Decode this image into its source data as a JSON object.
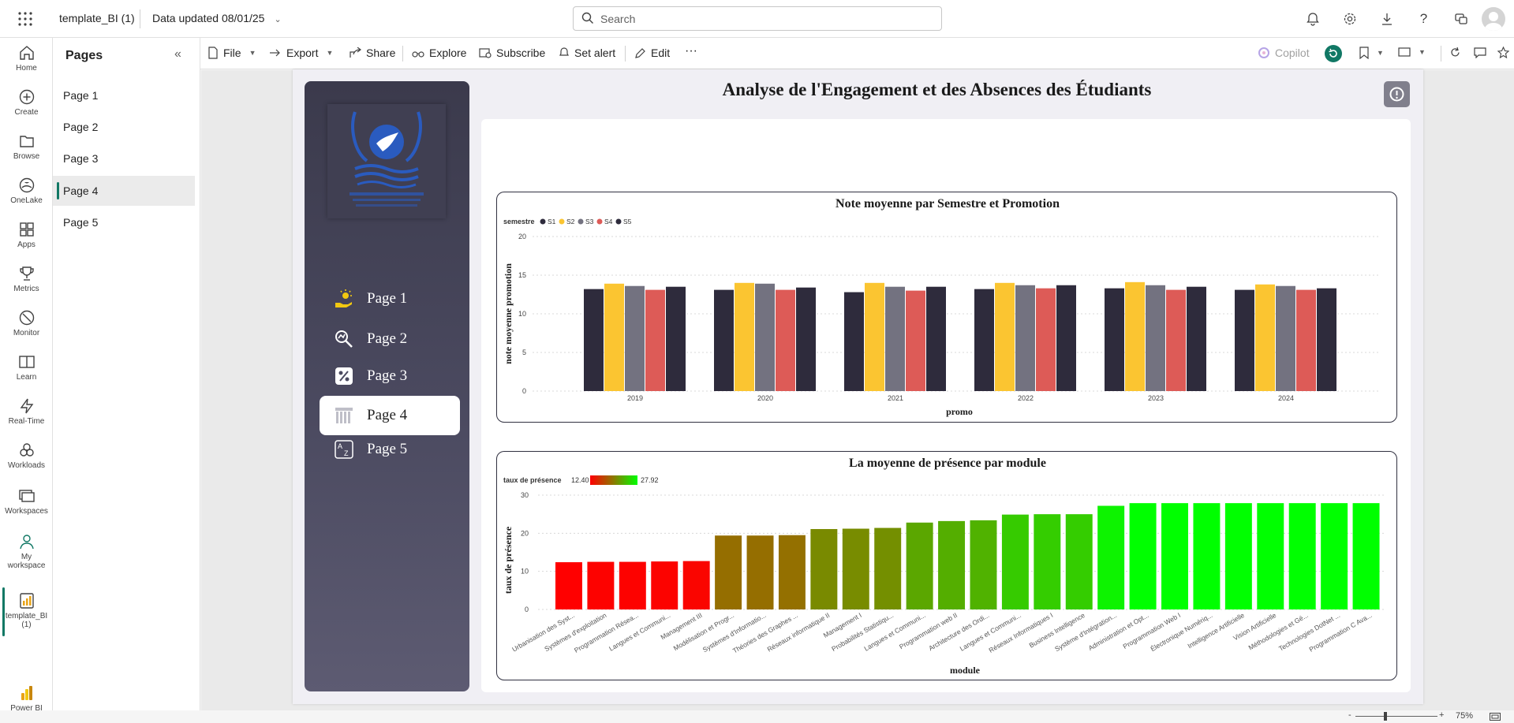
{
  "topbar": {
    "app_title": "template_BI (1)",
    "data_updated": "Data updated 08/01/25",
    "search_placeholder": "Search"
  },
  "rail": [
    {
      "label": "Home",
      "icon": "home-icon"
    },
    {
      "label": "Create",
      "icon": "create-icon"
    },
    {
      "label": "Browse",
      "icon": "browse-icon"
    },
    {
      "label": "OneLake",
      "icon": "onelake-icon"
    },
    {
      "label": "Apps",
      "icon": "apps-icon"
    },
    {
      "label": "Metrics",
      "icon": "metrics-icon"
    },
    {
      "label": "Monitor",
      "icon": "monitor-icon"
    },
    {
      "label": "Learn",
      "icon": "learn-icon"
    },
    {
      "label": "Real-Time",
      "icon": "real-time-icon"
    },
    {
      "label": "Workloads",
      "icon": "workloads-icon"
    },
    {
      "label": "Workspaces",
      "icon": "workspaces-icon"
    },
    {
      "label_line1": "My",
      "label_line2": "workspace",
      "icon": "my-workspace-icon"
    },
    {
      "label_line1": "template_BI",
      "label_line2": "(1)",
      "icon": "report-icon"
    },
    {
      "label": "Power BI",
      "icon": "power-bi-icon"
    }
  ],
  "pages_panel": {
    "title": "Pages",
    "items": [
      "Page 1",
      "Page 2",
      "Page 3",
      "Page 4",
      "Page 5"
    ],
    "active_index": 3
  },
  "toolbar": {
    "file": "File",
    "export": "Export",
    "share": "Share",
    "explore": "Explore",
    "subscribe": "Subscribe",
    "set_alert": "Set alert",
    "edit": "Edit",
    "more": "···",
    "copilot": "Copilot"
  },
  "report": {
    "title": "Analyse de l'Engagement et des Absences des Étudiants",
    "nav": [
      {
        "label": "Page 1",
        "icon": "sun-hand-icon"
      },
      {
        "label": "Page 2",
        "icon": "magnify-chart-icon"
      },
      {
        "label": "Page 3",
        "icon": "percent-icon"
      },
      {
        "label": "Page 4",
        "icon": "columns-icon"
      },
      {
        "label": "Page 5",
        "icon": "sort-az-icon"
      }
    ],
    "active_nav_index": 3
  },
  "chart_data": [
    {
      "type": "bar",
      "title": "Note moyenne par Semestre et Promotion",
      "xlabel": "promo",
      "ylabel": "note moyenne promotion",
      "legend_title": "semestre",
      "legend_placement": "top-left",
      "ylim": [
        0,
        20
      ],
      "yticks": [
        0,
        5,
        10,
        15,
        20
      ],
      "grid": true,
      "categories": [
        "2019",
        "2020",
        "2021",
        "2022",
        "2023",
        "2024"
      ],
      "series": [
        {
          "name": "S1",
          "color": "#2e2b3c",
          "values": [
            13.2,
            13.1,
            12.8,
            13.2,
            13.3,
            13.1
          ]
        },
        {
          "name": "S2",
          "color": "#fbc531",
          "values": [
            13.9,
            14.0,
            14.0,
            14.0,
            14.1,
            13.8
          ]
        },
        {
          "name": "S3",
          "color": "#737280",
          "values": [
            13.6,
            13.9,
            13.5,
            13.7,
            13.7,
            13.6
          ]
        },
        {
          "name": "S4",
          "color": "#dd5b57",
          "values": [
            13.1,
            13.1,
            13.0,
            13.3,
            13.1,
            13.1
          ]
        },
        {
          "name": "S5",
          "color": "#2e2b3c",
          "values": [
            13.5,
            13.4,
            13.5,
            13.7,
            13.5,
            13.3
          ]
        }
      ]
    },
    {
      "type": "bar",
      "title": "La moyenne de présence par module",
      "xlabel": "module",
      "ylabel": "taux de présence",
      "legend_title": "taux de présence",
      "legend_min": "12.40",
      "legend_max": "27.92",
      "legend_placement": "top-left",
      "ylim": [
        0,
        30
      ],
      "yticks": [
        0,
        10,
        20,
        30
      ],
      "grid": true,
      "color_min": "#ff0000",
      "color_mid": "#8a7a00",
      "color_max": "#00ff00",
      "categories": [
        "Urbanisation des Syst...",
        "Systèmes d'exploitation",
        "Programmation Résea...",
        "Langues et Communi...",
        "Management III",
        "Modélisation et Progr...",
        "Systèmes d'Informatio...",
        "Théories des Graphes ...",
        "Réseaux informatique II",
        "Management I",
        "Probabilités Statistiqu...",
        "Langues et Communi...",
        "Programmation web II",
        "Architecture des Ordi...",
        "Langues et Communi...",
        "Réseaux Informatiques I",
        "Business Intelligence",
        "Système d'Intégration...",
        "Administration et Opt...",
        "Programmation Web I",
        "Électronique Numériq...",
        "Intelligence Artificielle",
        "Vision Artificielle",
        "Méthodologies et Gé...",
        "Technologies DotNet ...",
        "Programmation C Ava..."
      ],
      "values": [
        12.4,
        12.5,
        12.5,
        12.6,
        12.7,
        19.4,
        19.4,
        19.5,
        21.1,
        21.2,
        21.4,
        22.8,
        23.2,
        23.4,
        24.9,
        25.0,
        25.0,
        27.2,
        27.9,
        27.9,
        27.9,
        27.9,
        27.9,
        27.9,
        27.9,
        27.9
      ]
    }
  ],
  "statusbar": {
    "zoom": "75%",
    "minus": "-",
    "plus": "+"
  }
}
